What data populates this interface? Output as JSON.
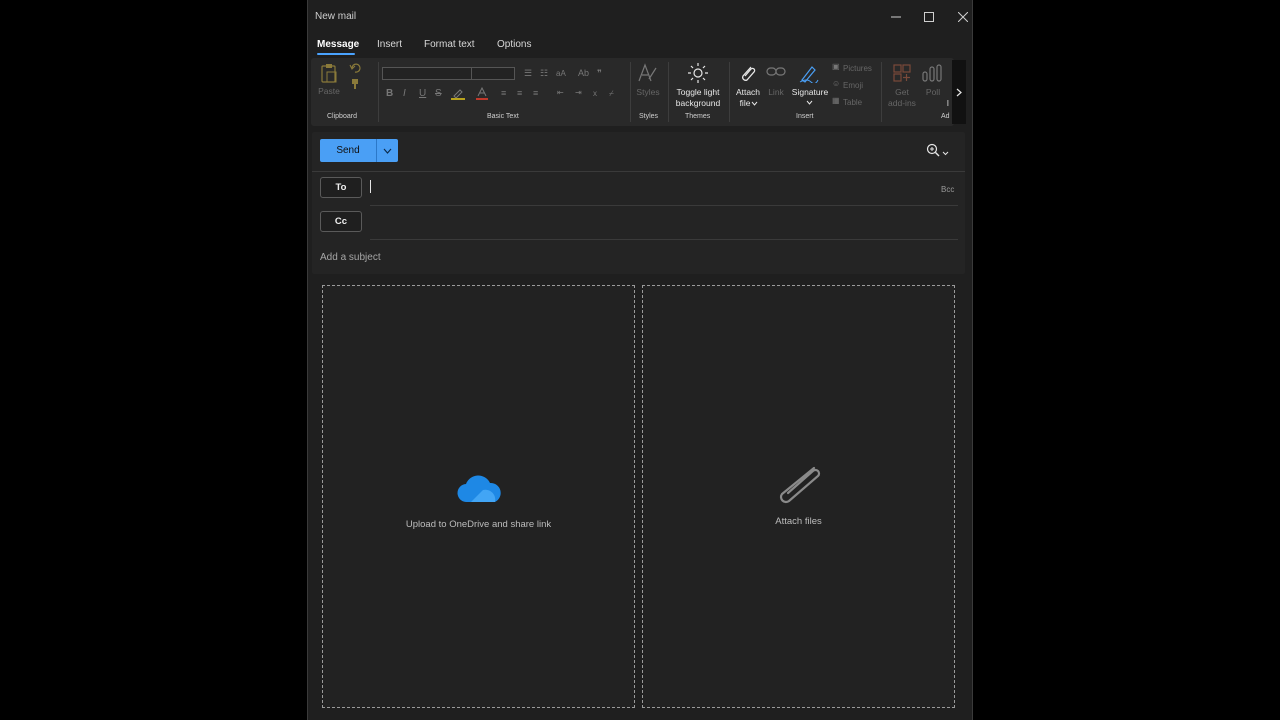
{
  "window": {
    "title": "New mail"
  },
  "tabs": [
    {
      "label": "Message",
      "active": true
    },
    {
      "label": "Insert"
    },
    {
      "label": "Format text"
    },
    {
      "label": "Options"
    }
  ],
  "ribbon": {
    "clipboard": {
      "group": "Clipboard",
      "paste": "Paste"
    },
    "basic_text": {
      "group": "Basic Text"
    },
    "styles": {
      "group": "Styles",
      "label": "Styles"
    },
    "themes": {
      "group": "Themes",
      "toggle_line1": "Toggle light",
      "toggle_line2": "background"
    },
    "insert": {
      "group": "Insert",
      "attach_line1": "Attach",
      "attach_line2": "file",
      "link": "Link",
      "signature": "Signature",
      "pictures": "Pictures",
      "emoji": "Emoji",
      "table": "Table"
    },
    "addins": {
      "group": "Ad",
      "get_line1": "Get",
      "get_line2": "add-ins",
      "poll": "Poll"
    }
  },
  "compose": {
    "send_label": "Send",
    "to_label": "To",
    "cc_label": "Cc",
    "bcc_label": "Bcc",
    "subject_placeholder": "Add a subject"
  },
  "drop_zones": {
    "onedrive_label": "Upload to OneDrive and share link",
    "attach_label": "Attach files"
  },
  "colors": {
    "accent": "#4a9ff5",
    "background": "#1f1f1f",
    "onedrive": "#1e88e5"
  }
}
